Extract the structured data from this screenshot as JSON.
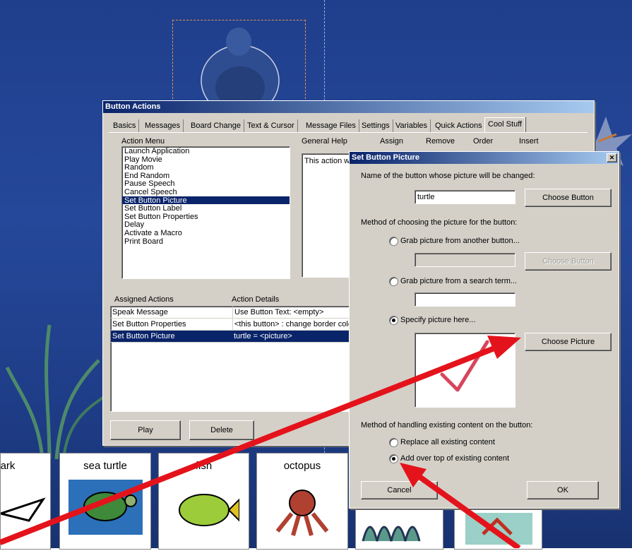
{
  "button_actions": {
    "title": "Button Actions",
    "tabs": [
      "Basics",
      "Messages",
      "Board Change",
      "Text & Cursor",
      "Message Files",
      "Settings",
      "Variables",
      "Quick Actions",
      "Cool Stuff"
    ],
    "active_tab": "Cool Stuff",
    "action_menu_label": "Action Menu",
    "action_menu": [
      "Launch Application",
      "Play Movie",
      "Random",
      "End Random",
      "Pause Speech",
      "Cancel Speech",
      "Set Button Picture",
      "Set Button Label",
      "Set Button Properties",
      "Delay",
      "Activate a Macro",
      "Print Board"
    ],
    "selected_action": "Set Button Picture",
    "col_headers": [
      "General Help",
      "Assign",
      "Remove",
      "Order",
      "Insert"
    ],
    "help_text": "This action w",
    "assigned_header": "Assigned Actions",
    "details_header": "Action Details",
    "assigned_rows": [
      {
        "action": "Speak Message",
        "details": "Use Button Text: <empty>"
      },
      {
        "action": "Set Button Properties",
        "details": "<this button> : change border color"
      },
      {
        "action": "Set Button Picture",
        "details": "turtle = <picture>"
      }
    ],
    "play_label": "Play",
    "delete_label": "Delete"
  },
  "set_picture": {
    "title": "Set Button Picture",
    "close_glyph": "✕",
    "name_label": "Name of the button whose picture will be changed:",
    "name_value": "turtle",
    "choose_button_label": "Choose Button",
    "method_label": "Method of choosing the picture for the button:",
    "opt_grab_button": "Grab picture from another button...",
    "choose_button_disabled_label": "Choose Button",
    "opt_search": "Grab picture from a search term...",
    "opt_specify": "Specify picture here...",
    "choose_picture_label": "Choose Picture",
    "existing_label": "Method of handling existing content on the button:",
    "opt_replace": "Replace all existing content",
    "opt_add": "Add over top of existing content",
    "cancel_label": "Cancel",
    "ok_label": "OK",
    "colors": {
      "checkmark": "#d0243f",
      "arrow": "#e4131b"
    }
  },
  "board": {
    "cards": [
      "ark",
      "sea turtle",
      "fish",
      "octopus"
    ]
  }
}
